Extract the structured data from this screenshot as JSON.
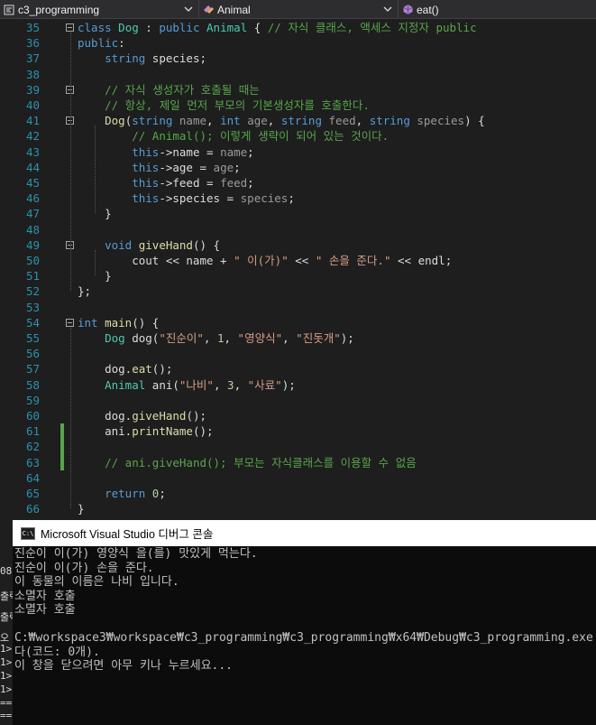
{
  "navbar": {
    "project": "c3_programming",
    "class": "Animal",
    "member": "eat()"
  },
  "editor": {
    "lines": [
      {
        "n": "35",
        "html": "<span class=\"kw\">class</span> <span class=\"ty\">Dog</span> : <span class=\"kw\">public</span> <span class=\"ty\">Animal</span> { <span class=\"cm\">// 자식 클래스, 액세스 지정자 public</span>"
      },
      {
        "n": "36",
        "html": "<span class=\"kw\">public</span>:"
      },
      {
        "n": "37",
        "html": "    <span class=\"kw\">string</span> species;"
      },
      {
        "n": "38",
        "html": ""
      },
      {
        "n": "39",
        "html": "    <span class=\"cm\">// 자식 생성자가 호출될 때는</span>"
      },
      {
        "n": "40",
        "html": "    <span class=\"cm\">// 항상, 제일 먼저 부모의 기본생성자를 호출한다.</span>"
      },
      {
        "n": "41",
        "html": "    <span class=\"fn\">Dog</span>(<span class=\"kw\">string</span> <span class=\"pm\">name</span>, <span class=\"kw\">int</span> <span class=\"pm\">age</span>, <span class=\"kw\">string</span> <span class=\"pm\">feed</span>, <span class=\"kw\">string</span> <span class=\"pm\">species</span>) {"
      },
      {
        "n": "42",
        "html": "        <span class=\"cm\">// Animal(); 이렇게 생략이 되어 있는 것이다.</span>"
      },
      {
        "n": "43",
        "html": "        <span class=\"kw\">this</span>-&gt;name = <span class=\"pm\">name</span>;"
      },
      {
        "n": "44",
        "html": "        <span class=\"kw\">this</span>-&gt;age = <span class=\"pm\">age</span>;"
      },
      {
        "n": "45",
        "html": "        <span class=\"kw\">this</span>-&gt;feed = <span class=\"pm\">feed</span>;"
      },
      {
        "n": "46",
        "html": "        <span class=\"kw\">this</span>-&gt;species = <span class=\"pm\">species</span>;"
      },
      {
        "n": "47",
        "html": "    }"
      },
      {
        "n": "48",
        "html": ""
      },
      {
        "n": "49",
        "html": "    <span class=\"kw\">void</span> <span class=\"fn\">giveHand</span>() {"
      },
      {
        "n": "50",
        "html": "        cout &lt;&lt; name + <span class=\"st\">\" 이(가)\"</span> &lt;&lt; <span class=\"st\">\" 손을 준다.\"</span> &lt;&lt; endl;"
      },
      {
        "n": "51",
        "html": "    }"
      },
      {
        "n": "52",
        "html": "};"
      },
      {
        "n": "53",
        "html": ""
      },
      {
        "n": "54",
        "html": "<span class=\"kw\">int</span> <span class=\"fn\">main</span>() {"
      },
      {
        "n": "55",
        "html": "    <span class=\"ty\">Dog</span> dog(<span class=\"st\">\"진순이\"</span>, <span class=\"nu\">1</span>, <span class=\"st\">\"영양식\"</span>, <span class=\"st\">\"진돗개\"</span>);"
      },
      {
        "n": "56",
        "html": ""
      },
      {
        "n": "57",
        "html": "    dog.<span class=\"fn\">eat</span>();"
      },
      {
        "n": "58",
        "html": "    <span class=\"ty\">Animal</span> ani(<span class=\"st\">\"나비\"</span>, <span class=\"nu\">3</span>, <span class=\"st\">\"사료\"</span>);"
      },
      {
        "n": "59",
        "html": ""
      },
      {
        "n": "60",
        "html": "    dog.<span class=\"fn\">giveHand</span>();"
      },
      {
        "n": "61",
        "html": "    ani.<span class=\"fn\">printName</span>();"
      },
      {
        "n": "62",
        "html": ""
      },
      {
        "n": "63",
        "html": "    <span class=\"cm\">// ani.giveHand(); 부모는 자식클래스를 이용할 수 없음</span>"
      },
      {
        "n": "64",
        "html": ""
      },
      {
        "n": "65",
        "html": "    <span class=\"kw\">return</span> <span class=\"nu\">0</span>;"
      },
      {
        "n": "66",
        "html": "}"
      }
    ]
  },
  "console": {
    "title": "Microsoft Visual Studio 디버그 콘솔",
    "icon_text": "C:\\",
    "lines": [
      "진순이 이(가) 영양식 을(를) 맛있게 먹는다.",
      "진순이 이(가) 손을 준다.",
      "이 동물의 이름은 나비 입니다.",
      "소멸자 호출",
      "소멸자 호출",
      "",
      "C:₩workspace3₩workspace₩c3_programming₩c3_programming₩x64₩Debug₩c3_programming.exe",
      "다(코드: 0개).",
      "이 창을 닫으려면 아무 키나 누르세요..."
    ]
  },
  "output_panel": {
    "fragments": [
      "08",
      "출력",
      "출력",
      "오",
      "1>",
      "1>",
      "1>",
      "1>",
      "==",
      "=="
    ]
  }
}
